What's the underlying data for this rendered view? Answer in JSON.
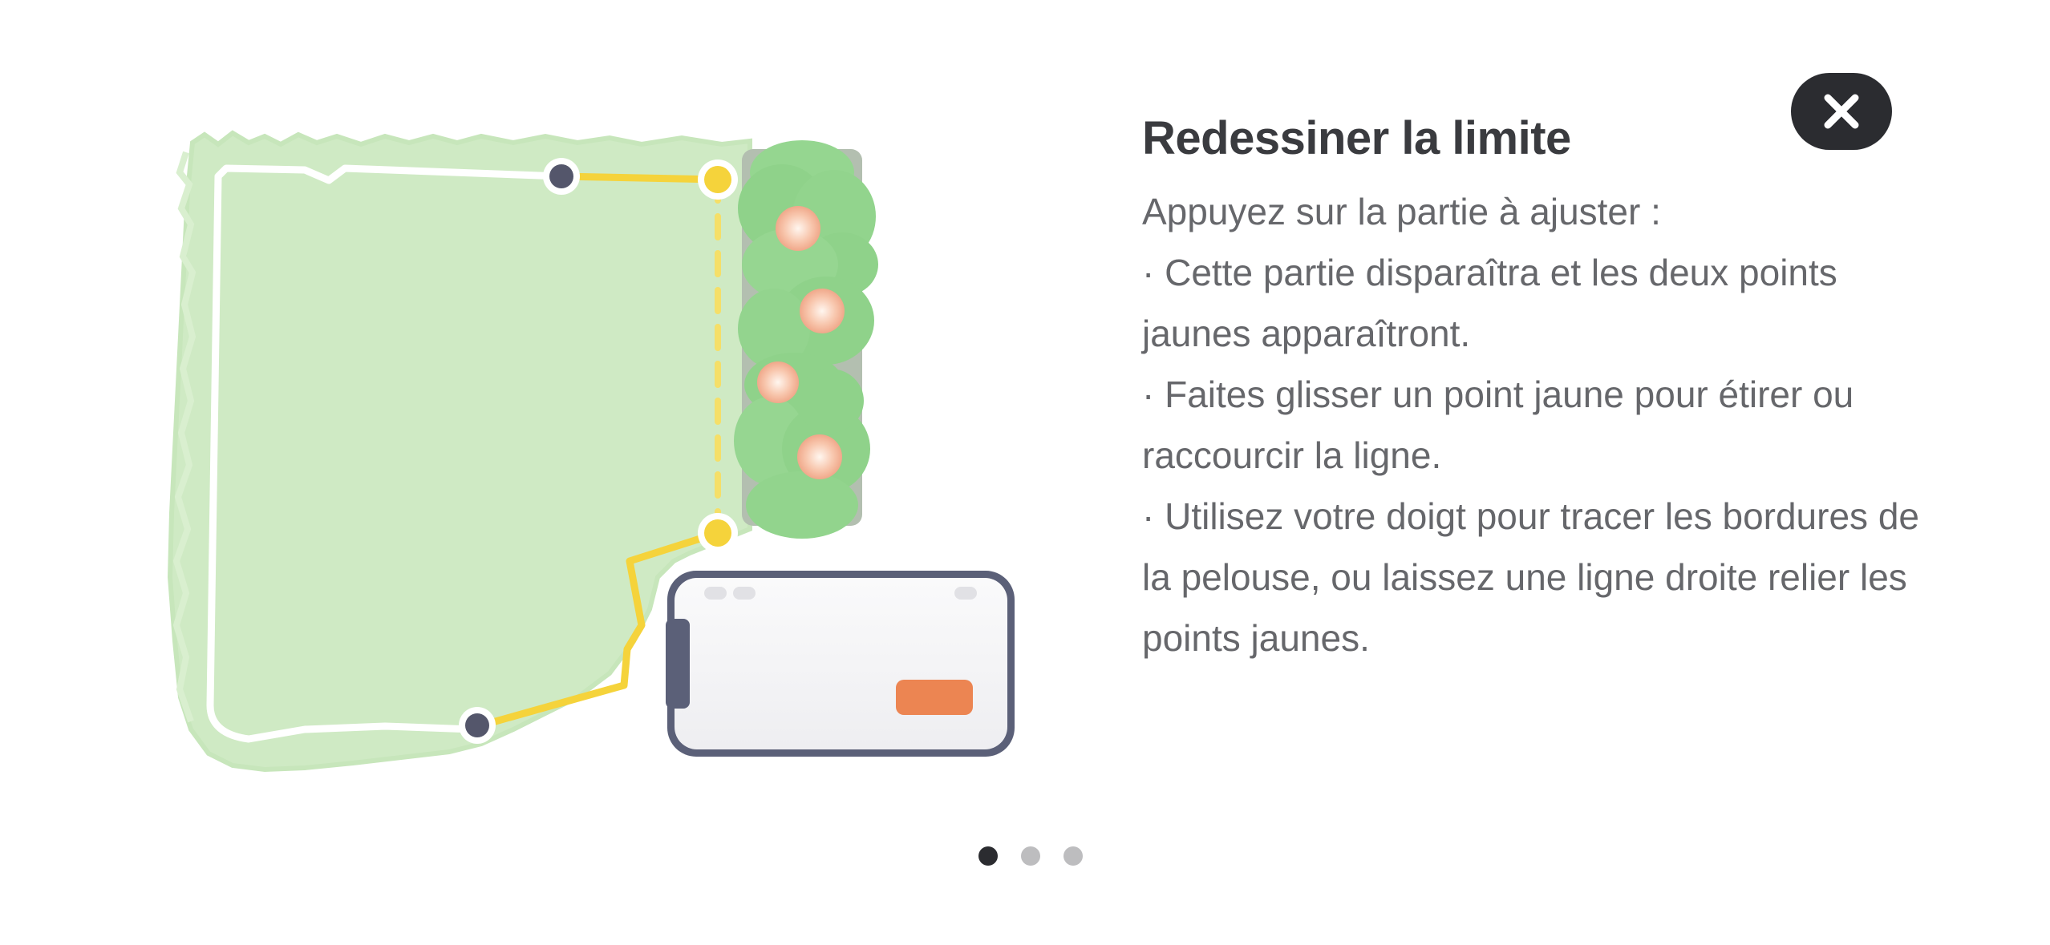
{
  "colors": {
    "background": "#ffffff",
    "title": "#3a3b3f",
    "body_text": "#66676b",
    "close_button_bg": "#2b2c30",
    "close_icon": "#ffffff",
    "lawn": "#cfeac4",
    "boundary_line": "#ffffff",
    "adjusted_segment": "#f5d33b",
    "anchor_point": "#54566b",
    "yellow_point": "#f5d33b",
    "hedge": "#8fd28a",
    "flowers": "#f8c7ae",
    "dock_frame": "#5b6078",
    "dock_button": "#ec8552",
    "pager_active": "#2b2c30",
    "pager_inactive": "#bdbdbf"
  },
  "modal": {
    "title": "Redessiner la limite",
    "close_icon": "close-icon",
    "instructions": [
      "Appuyez sur la partie à ajuster :",
      "· Cette partie disparaîtra et les deux points jaunes apparaîtront.",
      "· Faites glisser un point jaune pour étirer ou raccourcir la ligne.",
      "· Utilisez votre doigt pour tracer les bordures de la pelouse, ou laissez une ligne droite relier les points jaunes."
    ]
  },
  "illustration": {
    "elements": [
      "lawn-area",
      "boundary-line",
      "hedge",
      "charging-station"
    ]
  },
  "pager": {
    "total": 3,
    "current": 1
  }
}
